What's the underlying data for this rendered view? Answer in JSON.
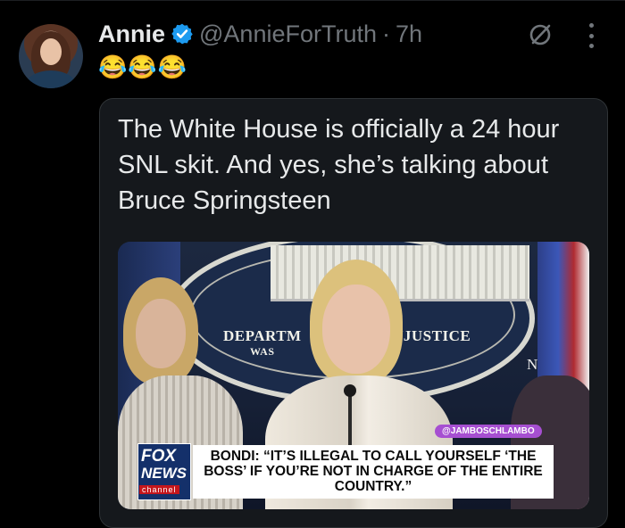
{
  "post": {
    "author_name": "Annie",
    "handle": "@AnnieForTruth",
    "separator": "·",
    "time": "7h",
    "emoji_text": "😂😂😂",
    "verified_color": "#1d9bf0"
  },
  "quote": {
    "text": "The White House is officially a 24 hour SNL skit.  And yes, she’s talking about Bruce Springsteen"
  },
  "media": {
    "seal_left": "DEPARTM",
    "seal_right": "INJUSTICE",
    "seal_small_left": "WAS",
    "seal_small_right": "ON",
    "side_letter": "N",
    "watermark": "@JAMBOSCHLAMBO",
    "logo_fox": "FOX",
    "logo_news": "NEWS",
    "logo_channel": "channel",
    "chyron": "BONDI: “IT’S ILLEGAL TO CALL YOURSELF ‘THE BOSS’ IF YOU’RE NOT IN CHARGE OF THE ENTIRE COUNTRY.”"
  },
  "colors": {
    "background": "#000000",
    "text_primary": "#e7e9ea",
    "text_secondary": "#71767b",
    "quote_border": "#2f3336"
  }
}
